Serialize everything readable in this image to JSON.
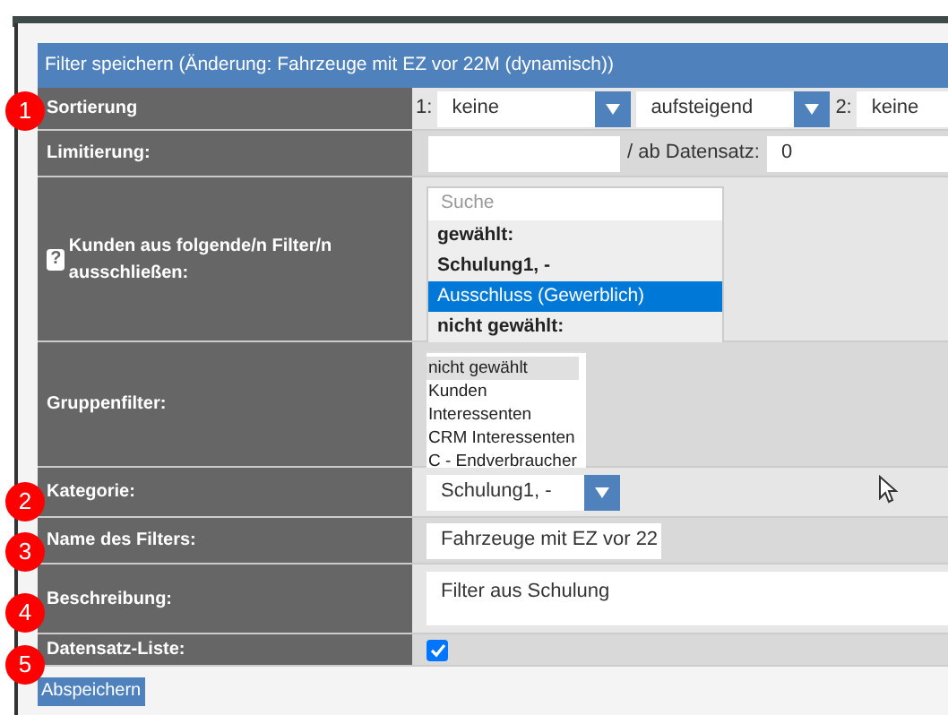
{
  "dialog": {
    "title": "Filter speichern (Änderung: Fahrzeuge mit EZ vor 22M (dynamisch))"
  },
  "rows": [
    {
      "kind": "sort",
      "label": "Sortierung",
      "badge": "1",
      "first_prefix": "1:",
      "first_value": "keine",
      "direction": "aufsteigend",
      "second_prefix": "2:",
      "second_value": "keine"
    },
    {
      "kind": "limit",
      "label": "Limitierung:",
      "offset_label": "/ ab Datensatz:",
      "offset_value": "0"
    },
    {
      "kind": "multiselect",
      "label": "Kunden aus folgende/n Filter/n ausschließen:",
      "help": "?",
      "search_placeholder": "Suche",
      "options": [
        {
          "kind": "group",
          "text": "gewählt:",
          "selected": false
        },
        {
          "kind": "group",
          "text": "Schulung1, -",
          "selected": false
        },
        {
          "kind": "option",
          "text": "Ausschluss (Gewerblich)",
          "selected": true
        },
        {
          "kind": "group",
          "text": "nicht gewählt:",
          "selected": false
        }
      ]
    },
    {
      "kind": "listbox",
      "label": "Gruppenfilter:",
      "options": [
        {
          "text": "nicht gewählt",
          "selected": true
        },
        {
          "text": "Kunden",
          "selected": false
        },
        {
          "text": "Interessenten",
          "selected": false
        },
        {
          "text": "CRM Interessenten",
          "selected": false
        },
        {
          "text": "C - Endverbraucher",
          "selected": false
        }
      ]
    },
    {
      "kind": "select",
      "label": "Kategorie:",
      "badge": "2",
      "value": "Schulung1, -"
    },
    {
      "kind": "text",
      "label": "Name des Filters:",
      "badge": "3",
      "value": "Fahrzeuge mit EZ vor 22"
    },
    {
      "kind": "textarea",
      "label": "Beschreibung:",
      "badge": "4",
      "value": "Filter aus Schulung"
    },
    {
      "kind": "checkbox",
      "label": "Datensatz-Liste:",
      "badge": "5",
      "checked": true
    }
  ],
  "save_button": "Abspeichern"
}
